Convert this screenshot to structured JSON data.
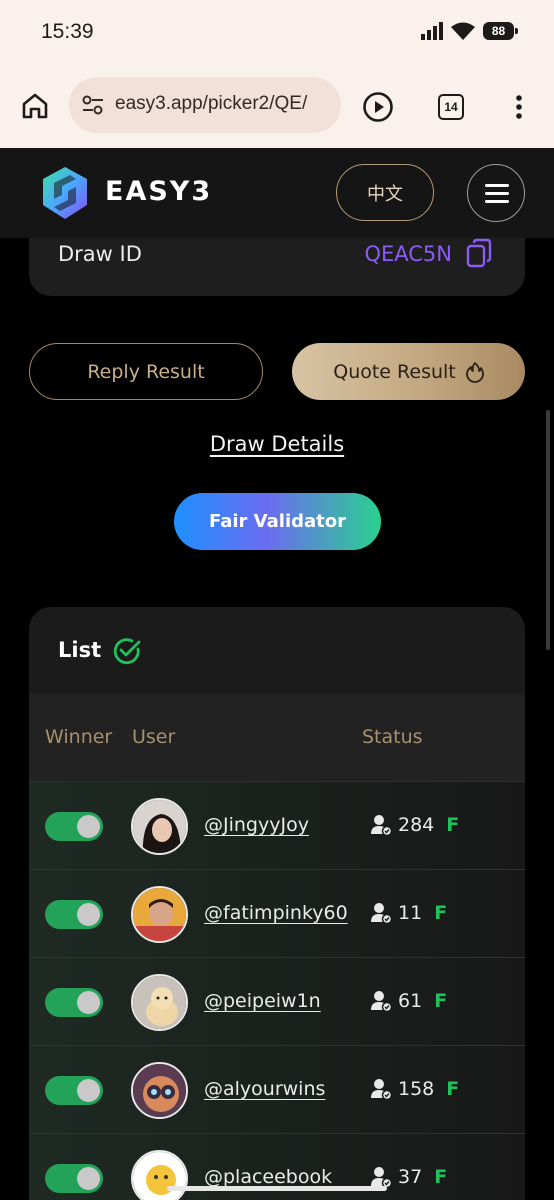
{
  "status_bar": {
    "time": "15:39",
    "battery": "88"
  },
  "browser": {
    "url": "easy3.app/picker2/QE/",
    "tab_count": "14"
  },
  "header": {
    "brand": "EASY3",
    "lang_label": "中文"
  },
  "draw": {
    "label": "Draw ID",
    "value": "QEAC5N"
  },
  "actions": {
    "reply_label": "Reply Result",
    "quote_label": "Quote Result",
    "details_label": "Draw Details",
    "validator_label": "Fair Validator"
  },
  "list": {
    "title": "List",
    "columns": {
      "winner": "Winner",
      "user": "User",
      "status": "Status"
    },
    "rows": [
      {
        "handle": "@JingyyJoy",
        "count": "284",
        "badge": "F",
        "winner": true
      },
      {
        "handle": "@fatimpinky60",
        "count": "11",
        "badge": "F",
        "winner": true
      },
      {
        "handle": "@peipeiw1n",
        "count": "61",
        "badge": "F",
        "winner": true
      },
      {
        "handle": "@alyourwins",
        "count": "158",
        "badge": "F",
        "winner": true
      },
      {
        "handle": "@placeebook",
        "count": "37",
        "badge": "F",
        "winner": true
      }
    ]
  },
  "colors": {
    "accent_purple": "#8a5cf5",
    "gold": "#c5ab84",
    "toggle_green": "#23a35a",
    "badge_green": "#1fc25a"
  },
  "icons": [
    "home-icon",
    "tune-icon",
    "play-icon",
    "tabs-icon",
    "more-vert-icon",
    "copy-icon",
    "fire-icon",
    "check-circle-icon",
    "user-verified-icon",
    "menu-icon"
  ]
}
